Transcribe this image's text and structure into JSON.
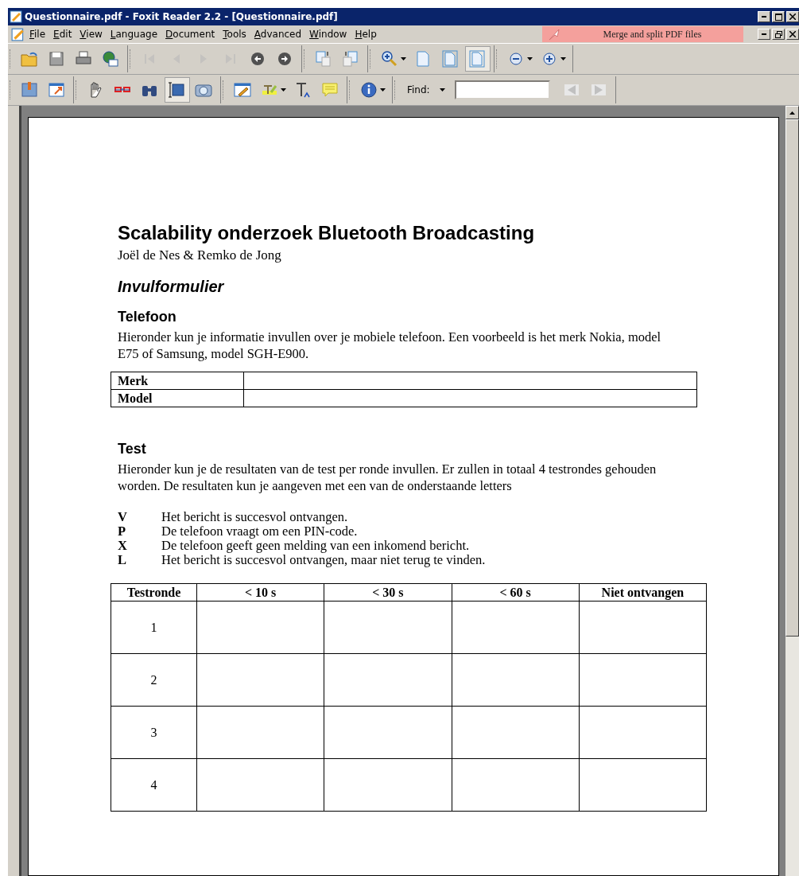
{
  "window": {
    "title": "Questionnaire.pdf - Foxit Reader 2.2 - [Questionnaire.pdf]"
  },
  "menu": [
    "File",
    "Edit",
    "View",
    "Language",
    "Document",
    "Tools",
    "Advanced",
    "Window",
    "Help"
  ],
  "promo": "Merge and split PDF files",
  "toolbar_1": [
    [
      {
        "kind": "open",
        "selected": false,
        "disabled": false,
        "dropdown": false
      },
      {
        "kind": "save",
        "selected": false,
        "disabled": false,
        "dropdown": false
      },
      {
        "kind": "print",
        "selected": false,
        "disabled": false,
        "dropdown": false
      },
      {
        "kind": "email",
        "selected": false,
        "disabled": false,
        "dropdown": false
      }
    ],
    [
      {
        "kind": "first",
        "selected": false,
        "disabled": true,
        "dropdown": false
      },
      {
        "kind": "prev",
        "selected": false,
        "disabled": true,
        "dropdown": false
      },
      {
        "kind": "next",
        "selected": false,
        "disabled": true,
        "dropdown": false
      },
      {
        "kind": "last",
        "selected": false,
        "disabled": true,
        "dropdown": false
      },
      {
        "kind": "back",
        "selected": false,
        "disabled": false,
        "dropdown": false
      },
      {
        "kind": "forward",
        "selected": false,
        "disabled": false,
        "dropdown": false
      }
    ],
    [
      {
        "kind": "pages_out",
        "selected": false,
        "disabled": false,
        "dropdown": false
      },
      {
        "kind": "pages_in",
        "selected": false,
        "disabled": false,
        "dropdown": false
      }
    ],
    [
      {
        "kind": "magnifier",
        "selected": false,
        "disabled": false,
        "dropdown": true
      },
      {
        "kind": "page",
        "selected": false,
        "disabled": false,
        "dropdown": false
      },
      {
        "kind": "page_framed",
        "selected": false,
        "disabled": false,
        "dropdown": false
      },
      {
        "kind": "page_framed",
        "selected": true,
        "disabled": false,
        "dropdown": false
      }
    ],
    [
      {
        "kind": "zoom_out",
        "selected": false,
        "disabled": false,
        "dropdown": true
      },
      {
        "kind": "zoom_in",
        "selected": false,
        "disabled": false,
        "dropdown": true
      }
    ]
  ],
  "toolbar_2": [
    [
      {
        "kind": "bookmark",
        "selected": false,
        "disabled": false,
        "dropdown": false
      },
      {
        "kind": "export",
        "selected": false,
        "disabled": false,
        "dropdown": false
      }
    ],
    [
      {
        "kind": "hand",
        "selected": false,
        "disabled": false,
        "dropdown": false
      },
      {
        "kind": "glasses",
        "selected": false,
        "disabled": false,
        "dropdown": false
      },
      {
        "kind": "binoculars",
        "selected": false,
        "disabled": false,
        "dropdown": false
      },
      {
        "kind": "text_select",
        "selected": true,
        "disabled": false,
        "dropdown": false
      },
      {
        "kind": "camera",
        "selected": false,
        "disabled": false,
        "dropdown": false
      }
    ],
    [
      {
        "kind": "pencil",
        "selected": false,
        "disabled": false,
        "dropdown": false
      },
      {
        "kind": "highlight",
        "selected": false,
        "disabled": false,
        "dropdown": true
      },
      {
        "kind": "text_tool",
        "selected": false,
        "disabled": false,
        "dropdown": false
      },
      {
        "kind": "note",
        "selected": false,
        "disabled": false,
        "dropdown": false
      }
    ],
    [
      {
        "kind": "info",
        "selected": false,
        "disabled": false,
        "dropdown": true
      }
    ]
  ],
  "find": {
    "label": "Find:",
    "prev_disabled": true,
    "next_disabled": true
  },
  "document": {
    "title": "Scalability onderzoek Bluetooth Broadcasting",
    "authors": "Joël de Nes & Remko de Jong",
    "subtitle": "Invulformulier",
    "phone": {
      "heading": "Telefoon",
      "text": "Hieronder kun je informatie invullen over je mobiele telefoon. Een voorbeeld is het merk Nokia, model E75 of Samsung, model SGH-E900.",
      "rows": [
        "Merk",
        "Model"
      ]
    },
    "test": {
      "heading": "Test",
      "text": "Hieronder kun je de resultaten van de test per ronde invullen. Er zullen in totaal 4 testrondes gehouden worden. De resultaten kun je aangeven met een van de onderstaande letters",
      "legend": [
        {
          "code": "V",
          "text": "Het bericht is succesvol ontvangen."
        },
        {
          "code": "P",
          "text": "De telefoon vraagt om een PIN-code."
        },
        {
          "code": "X",
          "text": "De telefoon geeft geen melding van een inkomend bericht."
        },
        {
          "code": "L",
          "text": "Het bericht is succesvol ontvangen, maar niet terug te vinden."
        }
      ],
      "columns": [
        "Testronde",
        "< 10 s",
        "< 30 s",
        "< 60 s",
        "Niet ontvangen"
      ],
      "rows": [
        "1",
        "2",
        "3",
        "4"
      ]
    }
  }
}
